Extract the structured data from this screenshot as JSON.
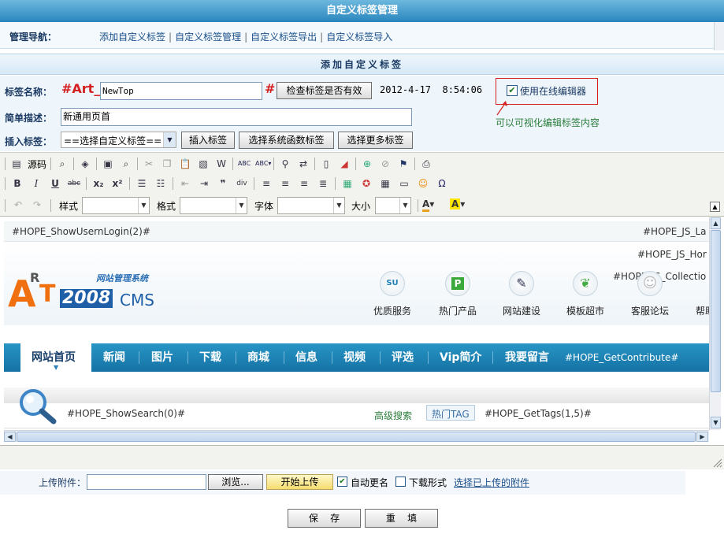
{
  "header": {
    "title": "自定义标签管理"
  },
  "nav": {
    "label": "管理导航：",
    "links": [
      "添加自定义标签",
      "自定义标签管理",
      "自定义标签导出",
      "自定义标签导入"
    ],
    "sep": "|"
  },
  "section": {
    "title": "添加自定义标签"
  },
  "form": {
    "name_label": "标签名称：",
    "prefix": "#Art_",
    "name_value": "NewTop",
    "suffix": "#",
    "check_button": "检查标签是否有效",
    "timestamp": "2012-4-17  8:54:06",
    "online_editor_label": "使用在线编辑器",
    "online_editor_checked": true,
    "hint": "可以可视化编辑标签内容",
    "desc_label": "简单描述：",
    "desc_value": "新通用页首",
    "insert_label": "插入标签：",
    "select_value": "==选择自定义标签==",
    "insert_button": "插入标签",
    "sysfunc_button": "选择系统函数标签",
    "more_button": "选择更多标签"
  },
  "toolbar": {
    "source_label": "源码",
    "style_label": "样式",
    "format_label": "格式",
    "font_label": "字体",
    "size_label": "大小",
    "bold": "B",
    "italic": "I",
    "underline": "U",
    "strike": "abc",
    "sub": "x₂",
    "sup": "x²",
    "omega": "Ω",
    "font_color_glyph": "A",
    "bg_color_glyph": "A"
  },
  "preview": {
    "top_left": "#HOPE_ShowUsernLogin(2)#",
    "top_right": "#HOPE_JS_La",
    "second_right": "#HOPE_JS_Hor",
    "third_right": "#HOPE_JS_Collectio",
    "logo_cms": "2008",
    "logo_cms2": "CMS",
    "logo_subtitle": "网站管理系统",
    "logo_a": "A",
    "logo_r": "R",
    "logo_t": "T",
    "icons": [
      {
        "label": "优质服务",
        "glyph": "SU"
      },
      {
        "label": "热门产品",
        "glyph": "P"
      },
      {
        "label": "网站建设",
        "glyph": "✎"
      },
      {
        "label": "模板超市",
        "glyph": "❦"
      },
      {
        "label": "客服论坛",
        "glyph": "☺"
      },
      {
        "label": "帮助",
        "glyph": ""
      }
    ],
    "menu": [
      "网站首页",
      "新闻",
      "图片",
      "下载",
      "商城",
      "信息",
      "视频",
      "评选",
      "Vip简介",
      "我要留言"
    ],
    "menu_extra": "#HOPE_GetContribute#",
    "search_tag": "#HOPE_ShowSearch(0)#",
    "adv_search": "高级搜索",
    "hot_tag": "热门TAG",
    "get_tags": "#HOPE_GetTags(1,5)#"
  },
  "upload": {
    "label": "上传附件：",
    "browse": "浏览...",
    "start": "开始上传",
    "auto_rename": "自动更名",
    "auto_rename_checked": true,
    "download_form": "下载形式",
    "download_checked": false,
    "choose_uploaded": "选择已上传的附件"
  },
  "actions": {
    "save": "保    存",
    "reset": "重    填"
  },
  "colors": {
    "accent": "#2588bd",
    "nav_link": "#1b4f8a",
    "red": "#d42020",
    "hint_green": "#2a7d3b"
  }
}
